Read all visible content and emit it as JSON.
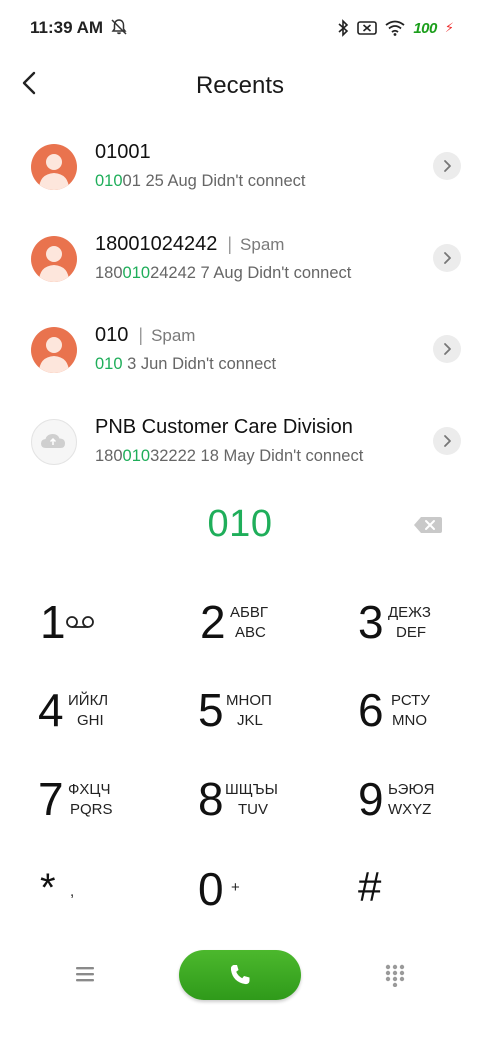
{
  "status_bar": {
    "time": "11:39 AM",
    "battery": "100",
    "icons": [
      "bell-off-icon",
      "bluetooth-icon",
      "sim-off-icon",
      "wifi-icon",
      "battery-icon",
      "charging-bolt-icon"
    ]
  },
  "header": {
    "title": "Recents",
    "back_icon": "back-arrow-icon"
  },
  "recents": [
    {
      "name": "01001",
      "tag": "",
      "detail_pre": "",
      "detail_hl": "010",
      "detail_post": "01",
      "date_status": " 25 Aug Didn't connect",
      "avatar": "person-orange"
    },
    {
      "name": "18001024242",
      "tag": "Spam",
      "detail_pre": "180",
      "detail_hl": "010",
      "detail_post": "24242",
      "date_status": " 7 Aug Didn't connect",
      "avatar": "person-orange"
    },
    {
      "name": "010",
      "tag": "Spam",
      "detail_pre": "",
      "detail_hl": "010",
      "detail_post": "",
      "date_status": " 3 Jun Didn't connect",
      "avatar": "person-orange"
    },
    {
      "name": "PNB Customer Care Division",
      "tag": "",
      "detail_pre": "180",
      "detail_hl": "010",
      "detail_post": "32222",
      "date_status": " 18 May Didn't connect",
      "avatar": "cloud-grey"
    }
  ],
  "dialed": "010",
  "keypad": {
    "k1": {
      "digit": "1",
      "sub1": "",
      "sub2": ""
    },
    "k2": {
      "digit": "2",
      "sub1": "АБВГ",
      "sub2": "ABC"
    },
    "k3": {
      "digit": "3",
      "sub1": "ДЕЖЗ",
      "sub2": "DEF"
    },
    "k4": {
      "digit": "4",
      "sub1": "ИЙКЛ",
      "sub2": "GHI"
    },
    "k5": {
      "digit": "5",
      "sub1": "МНОП",
      "sub2": "JKL"
    },
    "k6": {
      "digit": "6",
      "sub1": "РСТУ",
      "sub2": "MNO"
    },
    "k7": {
      "digit": "7",
      "sub1": "ФХЦЧ",
      "sub2": "PQRS"
    },
    "k8": {
      "digit": "8",
      "sub1": "ШЩЪЫ",
      "sub2": "TUV"
    },
    "k9": {
      "digit": "9",
      "sub1": "ЬЭЮЯ",
      "sub2": "WXYZ"
    },
    "kstar": {
      "digit": "*",
      "sub1": ",",
      "sub2": ""
    },
    "k0": {
      "digit": "0",
      "sub1": "+",
      "sub2": ""
    },
    "khash": {
      "digit": "#",
      "sub1": "",
      "sub2": ""
    }
  },
  "colors": {
    "accent_green": "#1fae5a",
    "call_green": "#3aa823",
    "avatar_orange": "#e9734e"
  }
}
